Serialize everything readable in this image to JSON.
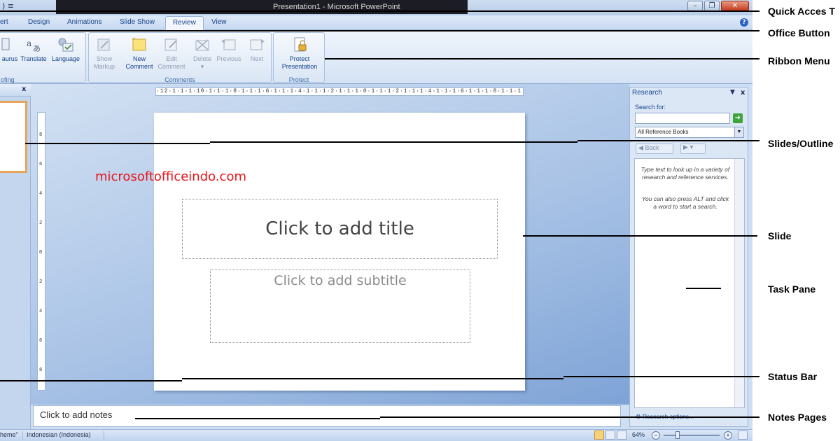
{
  "window": {
    "title": "Presentation1 - Microsoft PowerPoint"
  },
  "tabs": [
    {
      "label": "ert"
    },
    {
      "label": "Design"
    },
    {
      "label": "Animations"
    },
    {
      "label": "Slide Show"
    },
    {
      "label": "Review",
      "active": true
    },
    {
      "label": "View"
    }
  ],
  "ribbon": {
    "proofing": {
      "group_label": "ofing",
      "thesaurus": "aurus",
      "translate": "Translate",
      "language": "Language"
    },
    "markup": {
      "show_markup_1": "Show",
      "show_markup_2": "Markup"
    },
    "comments": {
      "group_label": "Comments",
      "new_1": "New",
      "new_2": "Comment",
      "edit_1": "Edit",
      "edit_2": "Comment",
      "delete": "Delete",
      "previous": "Previous",
      "next": "Next"
    },
    "protect": {
      "group_label": "Protect",
      "protect_1": "Protect",
      "protect_2": "Presentation"
    }
  },
  "ruler": {
    "horizontal": "·12·1·1·1·10·1·1·1·8·1·1·1·6·1·1·1·4·1·1·1·2·1·1·1·0·1·1·1·2·1·1·1·4·1·1·1·6·1·1·1·8·1·1·1·10·1·1·1·12·",
    "vertical": [
      "8",
      "6",
      "4",
      "2",
      "0",
      "2",
      "4",
      "6",
      "8"
    ]
  },
  "slide": {
    "title_placeholder": "Click to add title",
    "subtitle_placeholder": "Click to add subtitle",
    "watermark": "microsoftofficeindo.com"
  },
  "notes": {
    "placeholder": "Click to add notes"
  },
  "task_pane": {
    "title": "Research",
    "search_label": "Search for:",
    "search_value": "",
    "scope": "All Reference Books",
    "back_label": "Back",
    "message_1": "Type text to look up in a variety of research and reference services.",
    "message_2": "You can also press ALT and click a word to start a search.",
    "options_link": "Research options..."
  },
  "status_bar": {
    "theme": "heme\"",
    "language": "Indonesian (Indonesia)",
    "zoom": "64%"
  },
  "callouts": [
    {
      "label": "Quick Acces T"
    },
    {
      "label": "Office Button"
    },
    {
      "label": "Ribbon Menu"
    },
    {
      "label": "Slides/Outline"
    },
    {
      "label": "Slide"
    },
    {
      "label": "Task Pane"
    },
    {
      "label": "Status Bar"
    },
    {
      "label": "Notes Pages"
    }
  ],
  "colors": {
    "accent": "#15428b",
    "watermark": "#e8141a",
    "close_button": "#c43a1d"
  }
}
